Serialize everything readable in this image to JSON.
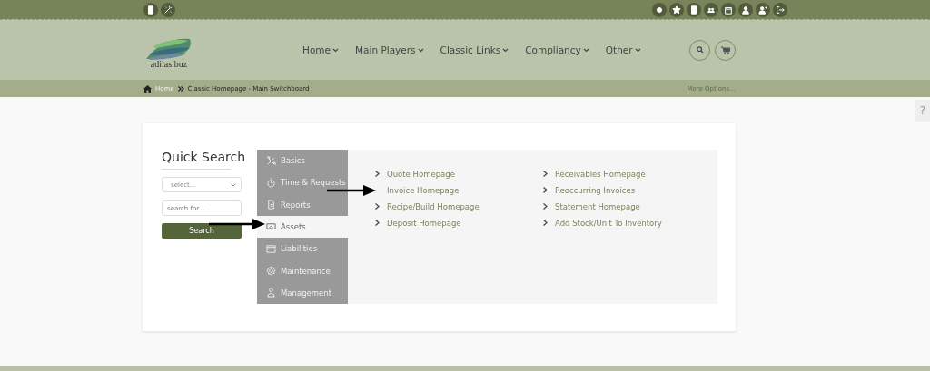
{
  "header": {
    "logo_text": "adilas.buz",
    "nav": [
      {
        "label": "Home"
      },
      {
        "label": "Main Players"
      },
      {
        "label": "Classic Links"
      },
      {
        "label": "Compliancy"
      },
      {
        "label": "Other"
      }
    ]
  },
  "breadcrumb": {
    "items": [
      "Home",
      "Classic Homepage - Main Switchboard"
    ],
    "more": "More Options..."
  },
  "help_tab": "?",
  "quick_search": {
    "title": "Quick Search",
    "select_placeholder": "select...",
    "search_placeholder": "search for...",
    "button": "Search"
  },
  "menu": [
    {
      "label": "Basics",
      "selected": false
    },
    {
      "label": "Time & Requests",
      "selected": false
    },
    {
      "label": "Reports",
      "selected": false
    },
    {
      "label": "Assets",
      "selected": true
    },
    {
      "label": "Liabilities",
      "selected": false
    },
    {
      "label": "Maintenance",
      "selected": false
    },
    {
      "label": "Management",
      "selected": false
    }
  ],
  "links": [
    {
      "label": "Quote Homepage",
      "arrow": false
    },
    {
      "label": "Receivables Homepage",
      "arrow": false
    },
    {
      "label": "Invoice Homepage",
      "arrow": true
    },
    {
      "label": "Reoccurring Invoices",
      "arrow": false
    },
    {
      "label": "Recipe/Build Homepage",
      "arrow": false
    },
    {
      "label": "Statement Homepage",
      "arrow": false
    },
    {
      "label": "Deposit Homepage",
      "arrow": false
    },
    {
      "label": "Add Stock/Unit To Inventory",
      "arrow": false
    }
  ]
}
